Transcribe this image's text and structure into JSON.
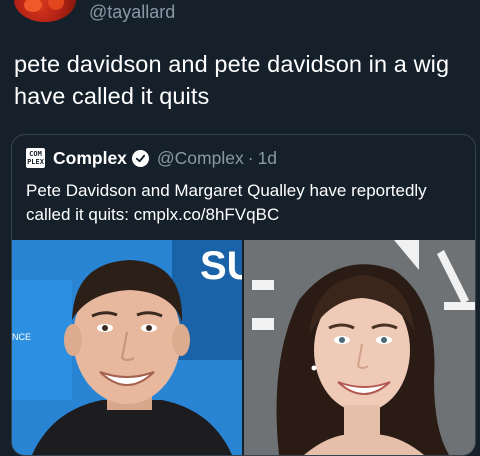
{
  "author": {
    "handle": "@tayallard"
  },
  "tweet": {
    "text": "pete davidson and pete davidson in a wig have called it quits"
  },
  "quote": {
    "logo_text_top": "COM",
    "logo_text_bottom": "PLEX",
    "name": "Complex",
    "handle": "@Complex",
    "separator": "·",
    "time": "1d",
    "text": "Pete Davidson and Margaret Qualley have reportedly called it quits: cmplx.co/8hFVqBC",
    "photo_left_sign": "SU",
    "photo_left_small": "NCE"
  },
  "colors": {
    "background": "#15202b",
    "secondary_text": "#8899a6",
    "border": "#38444d"
  }
}
